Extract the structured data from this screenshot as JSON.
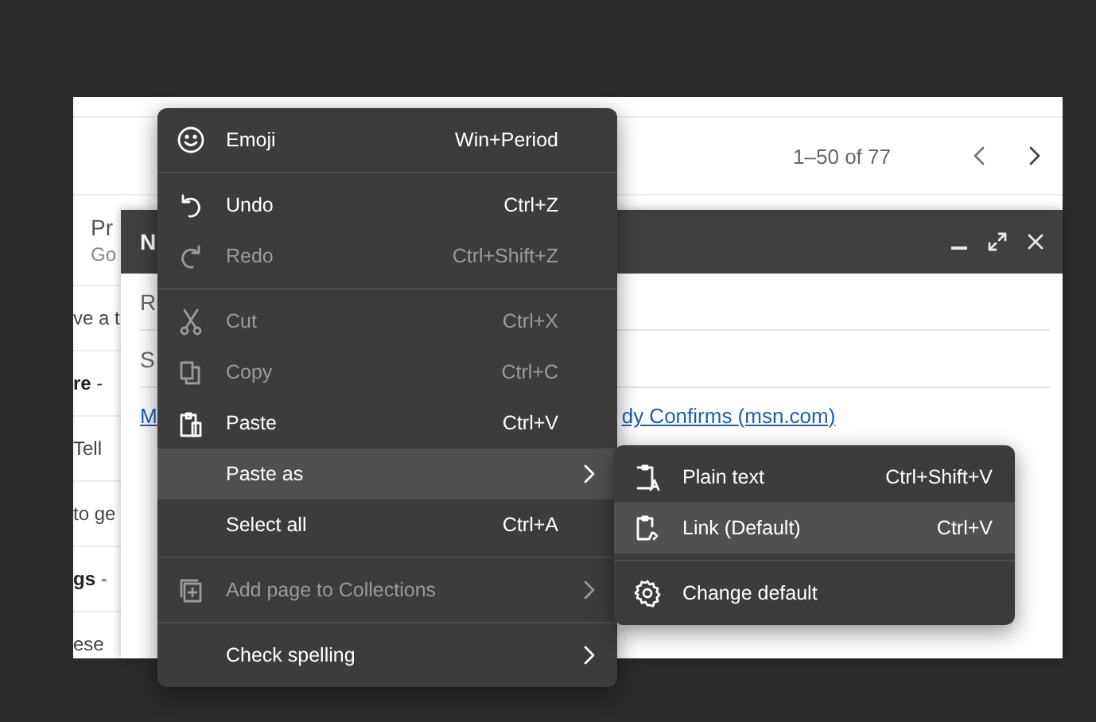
{
  "email_list": {
    "pagination": "1–50 of 77",
    "rows": [
      {
        "text": "Pr",
        "subtext": "Go"
      },
      {
        "text": "ve a t"
      },
      {
        "text": "**re** -"
      },
      {
        "text": "Tell"
      },
      {
        "text": "to ge"
      },
      {
        "text": "**gs** -"
      },
      {
        "text": "ese"
      }
    ]
  },
  "compose": {
    "title": "N",
    "fields": [
      "R",
      "S"
    ],
    "link_parts": [
      "M",
      "dy Confirms (msn.com)"
    ]
  },
  "menu": {
    "sections": [
      {
        "items": [
          {
            "kind": "emoji",
            "label": "Emoji",
            "shortcut": "Win+Period",
            "disabled": false,
            "selected": false,
            "submenu": false
          }
        ]
      },
      {
        "items": [
          {
            "kind": "undo",
            "label": "Undo",
            "shortcut": "Ctrl+Z",
            "disabled": false,
            "selected": false,
            "submenu": false
          },
          {
            "kind": "redo",
            "label": "Redo",
            "shortcut": "Ctrl+Shift+Z",
            "disabled": true,
            "selected": false,
            "submenu": false
          }
        ]
      },
      {
        "items": [
          {
            "kind": "cut",
            "label": "Cut",
            "shortcut": "Ctrl+X",
            "disabled": true,
            "selected": false,
            "submenu": false
          },
          {
            "kind": "copy",
            "label": "Copy",
            "shortcut": "Ctrl+C",
            "disabled": true,
            "selected": false,
            "submenu": false
          },
          {
            "kind": "paste",
            "label": "Paste",
            "shortcut": "Ctrl+V",
            "disabled": false,
            "selected": false,
            "submenu": false
          },
          {
            "kind": "none",
            "label": "Paste as",
            "disabled": false,
            "selected": true,
            "submenu": true
          },
          {
            "kind": "none",
            "label": "Select all",
            "shortcut": "Ctrl+A",
            "disabled": false,
            "selected": false,
            "submenu": false
          }
        ]
      },
      {
        "items": [
          {
            "kind": "collections",
            "label": "Add page to Collections",
            "disabled": true,
            "selected": false,
            "submenu": true
          }
        ]
      },
      {
        "items": [
          {
            "kind": "none",
            "label": "Check spelling",
            "disabled": false,
            "selected": false,
            "submenu": true
          }
        ]
      }
    ]
  },
  "submenu": {
    "sections": [
      {
        "items": [
          {
            "kind": "plain",
            "label": "Plain text",
            "shortcut": "Ctrl+Shift+V",
            "selected": false
          },
          {
            "kind": "link",
            "label": "Link (Default)",
            "shortcut": "Ctrl+V",
            "selected": true
          }
        ]
      },
      {
        "items": [
          {
            "kind": "gear",
            "label": "Change default",
            "selected": false
          }
        ]
      }
    ]
  }
}
